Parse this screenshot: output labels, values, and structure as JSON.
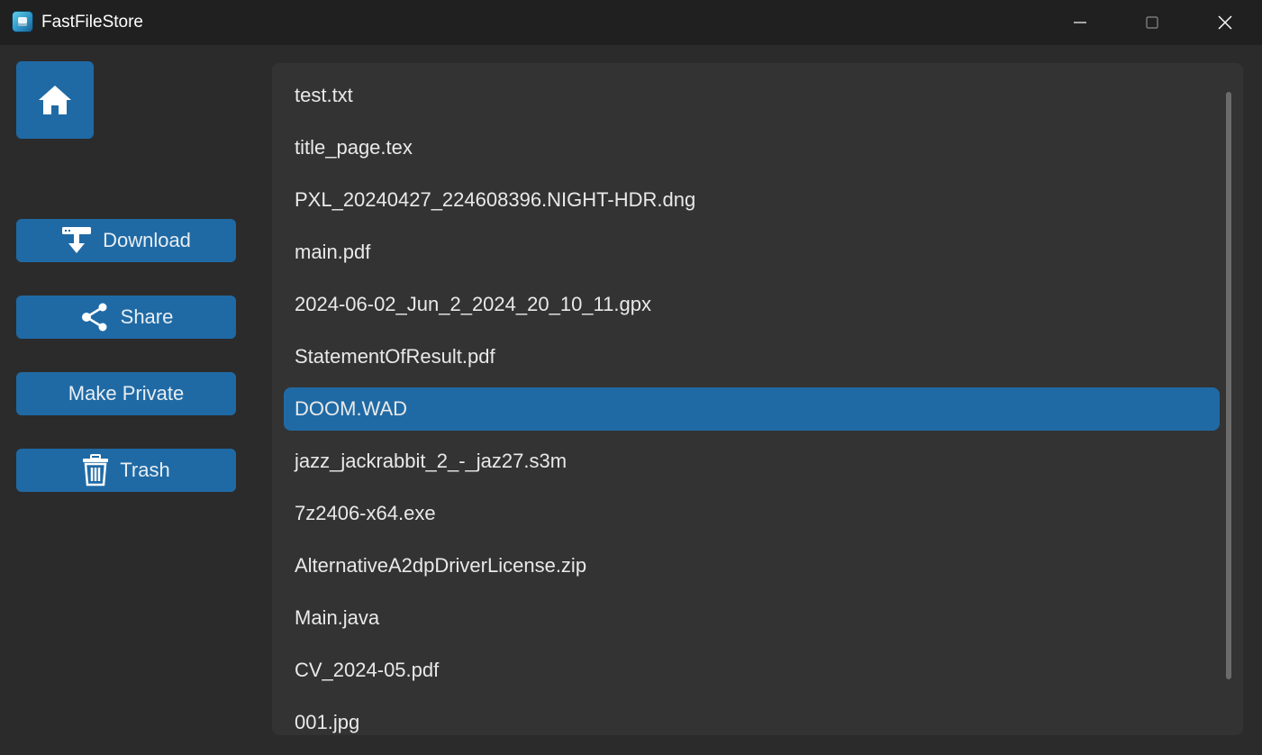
{
  "window": {
    "title": "FastFileStore",
    "app_icon": "fastfilestore-app-icon",
    "controls": {
      "minimize": "minimize-icon",
      "maximize": "maximize-icon",
      "close": "close-icon"
    }
  },
  "sidebar": {
    "home": {
      "icon": "home-icon"
    },
    "buttons": [
      {
        "label": "Download",
        "icon": "download-icon"
      },
      {
        "label": "Share",
        "icon": "share-icon"
      },
      {
        "label": "Make Private",
        "icon": ""
      },
      {
        "label": "Trash",
        "icon": "trash-icon"
      }
    ]
  },
  "files": {
    "items": [
      "test.txt",
      "title_page.tex",
      "PXL_20240427_224608396.NIGHT-HDR.dng",
      "main.pdf",
      "2024-06-02_Jun_2_2024_20_10_11.gpx",
      "StatementOfResult.pdf",
      "DOOM.WAD",
      "jazz_jackrabbit_2_-_jaz27.s3m",
      "7z2406-x64.exe",
      "AlternativeA2dpDriverLicense.zip",
      "Main.java",
      "CV_2024-05.pdf",
      "001.jpg"
    ],
    "selected_index": 6
  },
  "colors": {
    "accent": "#1f6aa5",
    "titlebar": "#202020",
    "background": "#2b2b2b",
    "panel": "#333333",
    "text": "#e9e9e9"
  }
}
